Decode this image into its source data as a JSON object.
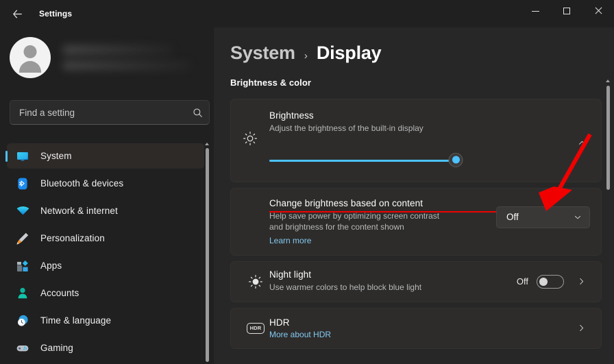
{
  "titlebar": {
    "back_label": "back-arrow",
    "title": "Settings",
    "minimize": "minimize",
    "maximize": "maximize",
    "close": "close"
  },
  "sidebar": {
    "account": {
      "name_redacted": "",
      "email_redacted": ""
    },
    "search": {
      "placeholder": "Find a setting",
      "value": ""
    },
    "items": [
      {
        "label": "System",
        "icon": "monitor-icon",
        "selected": true
      },
      {
        "label": "Bluetooth & devices",
        "icon": "bluetooth-icon",
        "selected": false
      },
      {
        "label": "Network & internet",
        "icon": "wifi-icon",
        "selected": false
      },
      {
        "label": "Personalization",
        "icon": "paintbrush-icon",
        "selected": false
      },
      {
        "label": "Apps",
        "icon": "apps-icon",
        "selected": false
      },
      {
        "label": "Accounts",
        "icon": "person-icon",
        "selected": false
      },
      {
        "label": "Time & language",
        "icon": "clock-icon",
        "selected": false
      },
      {
        "label": "Gaming",
        "icon": "gamepad-icon",
        "selected": false
      }
    ]
  },
  "main": {
    "breadcrumb": {
      "parent": "System",
      "separator": "›",
      "current": "Display"
    },
    "section_title": "Brightness & color",
    "brightness": {
      "title": "Brightness",
      "subtitle": "Adjust the brightness of the built-in display",
      "icon": "brightness-sun-icon",
      "expand_icon": "chevron-up-icon",
      "slider_value": 100,
      "slider_min": 0,
      "slider_max": 100
    },
    "content_adaptive": {
      "title": "Change brightness based on content",
      "subtitle_line1": "Help save power by optimizing screen contrast",
      "subtitle_line2": "and brightness for the content shown",
      "learn_more": "Learn more",
      "dropdown_value": "Off",
      "dropdown_icon": "chevron-down-icon"
    },
    "night_light": {
      "title": "Night light",
      "subtitle": "Use warmer colors to help block blue light",
      "icon": "night-light-sun-icon",
      "state_label": "Off",
      "toggle_on": false,
      "chevron": "chevron-right-icon"
    },
    "hdr": {
      "title": "HDR",
      "link": "More about HDR",
      "icon": "hdr-badge-icon",
      "chevron": "chevron-right-icon"
    }
  },
  "annotations": {
    "arrow_color": "#f20000",
    "underline_color": "#f20000"
  },
  "colors": {
    "accent": "#4cc2ff",
    "window_bg": "#202020",
    "content_bg": "#272727",
    "card_bg": "#2d2c2b",
    "link": "#84c9f0"
  }
}
